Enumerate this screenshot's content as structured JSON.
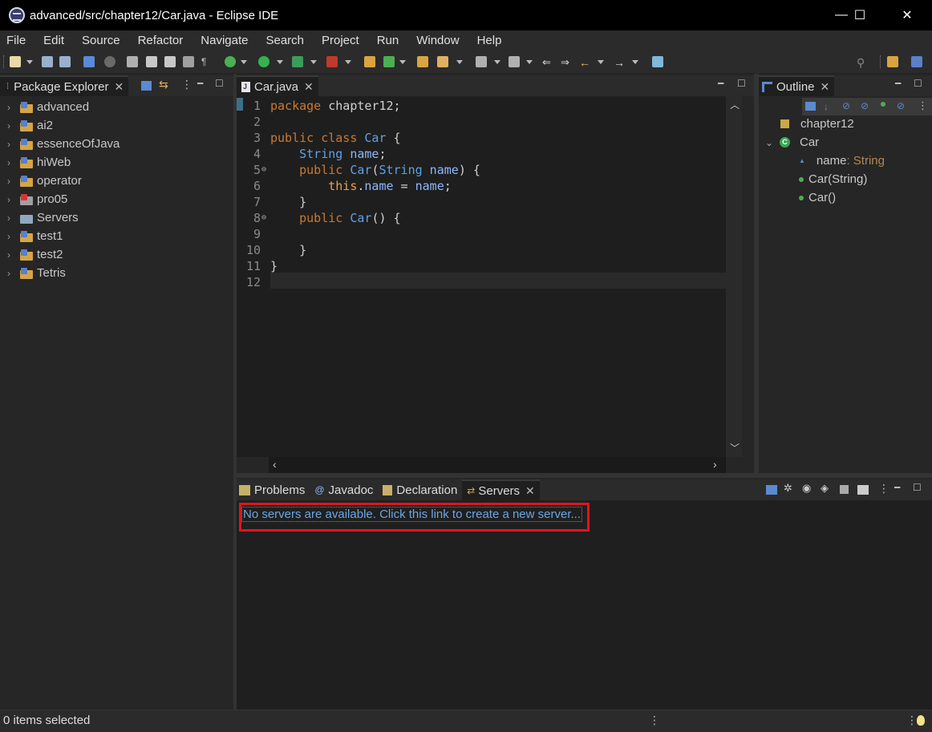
{
  "window": {
    "title": "advanced/src/chapter12/Car.java - Eclipse IDE",
    "minimize": "—",
    "maximize": "☐",
    "close": "✕"
  },
  "menu": [
    "File",
    "Edit",
    "Source",
    "Refactor",
    "Navigate",
    "Search",
    "Project",
    "Run",
    "Window",
    "Help"
  ],
  "package_explorer": {
    "tab_label": "Package Explorer",
    "projects": [
      "advanced",
      "ai2",
      "essenceOfJava",
      "hiWeb",
      "operator",
      "pro05",
      "Servers",
      "test1",
      "test2",
      "Tetris"
    ]
  },
  "editor": {
    "tab_label": "Car.java",
    "lines": [
      {
        "n": "1",
        "marker": ""
      },
      {
        "n": "2",
        "marker": ""
      },
      {
        "n": "3",
        "marker": ""
      },
      {
        "n": "4",
        "marker": ""
      },
      {
        "n": "5",
        "marker": "⊖"
      },
      {
        "n": "6",
        "marker": ""
      },
      {
        "n": "7",
        "marker": ""
      },
      {
        "n": "8",
        "marker": "⊖"
      },
      {
        "n": "9",
        "marker": ""
      },
      {
        "n": "10",
        "marker": ""
      },
      {
        "n": "11",
        "marker": ""
      },
      {
        "n": "12",
        "marker": ""
      }
    ],
    "code": {
      "l1_kw": "package",
      "l1_rest": " chapter12;",
      "l3_kw1": "public",
      "l3_kw2": " class",
      "l3_name": " Car",
      "l3_rest": " {",
      "l4_type": "String",
      "l4_field": " name",
      "l4_rest": ";",
      "l5_kw": "public",
      "l5_ctor": " Car",
      "l5_paren": "(",
      "l5_type": "String",
      "l5_param": " name",
      "l5_rest": ") {",
      "l6_this": "this",
      "l6_dot": ".",
      "l6_field": "name",
      "l6_eq": " = ",
      "l6_param": "name",
      "l6_rest": ";",
      "l7": "}",
      "l8_kw": "public",
      "l8_ctor": " Car",
      "l8_rest": "() {",
      "l10": "}",
      "l11": "}"
    }
  },
  "outline": {
    "tab_label": "Outline",
    "package": "chapter12",
    "class": "Car",
    "field_name": "name",
    "field_type": " : String",
    "methods": [
      "Car(String)",
      "Car()"
    ]
  },
  "bottom_panel": {
    "tabs": [
      "Problems",
      "Javadoc",
      "Declaration",
      "Servers"
    ],
    "active_tab": "Servers",
    "servers_link": "No servers are available. Click this link to create a new server..."
  },
  "status": {
    "text": "0 items selected"
  },
  "colors": {
    "highlight_box": "#e0141e",
    "link": "#6aa7e3"
  }
}
